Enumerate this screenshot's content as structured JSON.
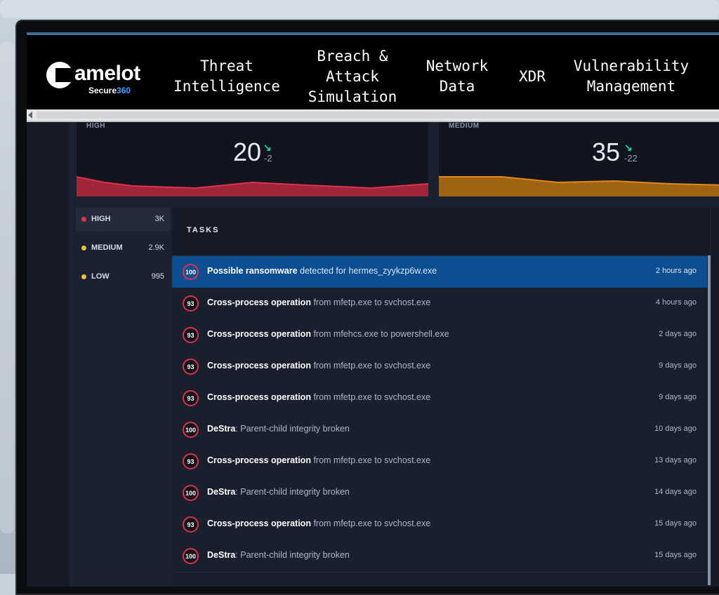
{
  "brand": {
    "name": "amelot",
    "sub_prefix": "Secure",
    "sub_suffix": "360"
  },
  "nav": [
    {
      "label": "Threat\nIntelligence"
    },
    {
      "label": "Breach &\nAttack\nSimulation"
    },
    {
      "label": "Network\nData"
    },
    {
      "label": "XDR"
    },
    {
      "label": "Vulnerability\nManagement"
    }
  ],
  "kpis": [
    {
      "label": "HIGH",
      "value": "20",
      "delta": "-2",
      "color": "#e0304a"
    },
    {
      "label": "MEDIUM",
      "value": "35",
      "delta": "-22",
      "color": "#e08a18"
    }
  ],
  "severity": [
    {
      "name": "HIGH",
      "count": "3K",
      "color": "#e0304a"
    },
    {
      "name": "MEDIUM",
      "count": "2.9K",
      "color": "#f2c13a"
    },
    {
      "name": "LOW",
      "count": "995",
      "color": "#f2c13a"
    }
  ],
  "tasks": {
    "title": "TASKS",
    "rows": [
      {
        "score": "100",
        "strong": "Possible ransomware",
        "rest": " detected for hermes_zyykzp6w.exe",
        "time": "2 hours ago"
      },
      {
        "score": "93",
        "strong": "Cross-process operation",
        "rest": " from mfetp.exe to svchost.exe",
        "time": "4 hours ago"
      },
      {
        "score": "93",
        "strong": "Cross-process operation",
        "rest": " from mfehcs.exe to powershell.exe",
        "time": "2 days ago"
      },
      {
        "score": "93",
        "strong": "Cross-process operation",
        "rest": " from mfetp.exe to svchost.exe",
        "time": "9 days ago"
      },
      {
        "score": "93",
        "strong": "Cross-process operation",
        "rest": " from mfetp.exe to svchost.exe",
        "time": "9 days ago"
      },
      {
        "score": "100",
        "strong": "DeStra",
        "rest": ": Parent-child integrity broken",
        "time": "10 days ago"
      },
      {
        "score": "93",
        "strong": "Cross-process operation",
        "rest": " from mfetp.exe to svchost.exe",
        "time": "13 days ago"
      },
      {
        "score": "100",
        "strong": "DeStra",
        "rest": ": Parent-child integrity broken",
        "time": "14 days ago"
      },
      {
        "score": "93",
        "strong": "Cross-process operation",
        "rest": " from mfetp.exe to svchost.exe",
        "time": "15 days ago"
      },
      {
        "score": "100",
        "strong": "DeStra",
        "rest": ": Parent-child integrity broken",
        "time": "15 days ago"
      }
    ]
  }
}
